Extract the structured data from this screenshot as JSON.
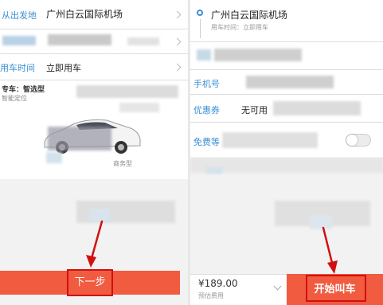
{
  "left": {
    "origin_label": "从出发地",
    "origin_value": "广州白云国际机场",
    "time_label": "用车时间",
    "time_value": "立即用车",
    "car_type_label": "专车：智选型",
    "car_type_sub": "智能定位",
    "car_caption": "商务型",
    "next_button": "下一步"
  },
  "right": {
    "origin_value": "广州白云国际机场",
    "origin_sub": "用车时间：立即用车",
    "phone_label": "手机号",
    "coupon_label": "优惠券",
    "coupon_value": "无可用",
    "toggle_label": "免费等",
    "price": "¥189.00",
    "price_sub": "预估费用",
    "start_button": "开始叫车"
  },
  "colors": {
    "accent_orange": "#f15b40",
    "label_blue": "#3a8fd6",
    "annotation_red": "#d01010"
  }
}
